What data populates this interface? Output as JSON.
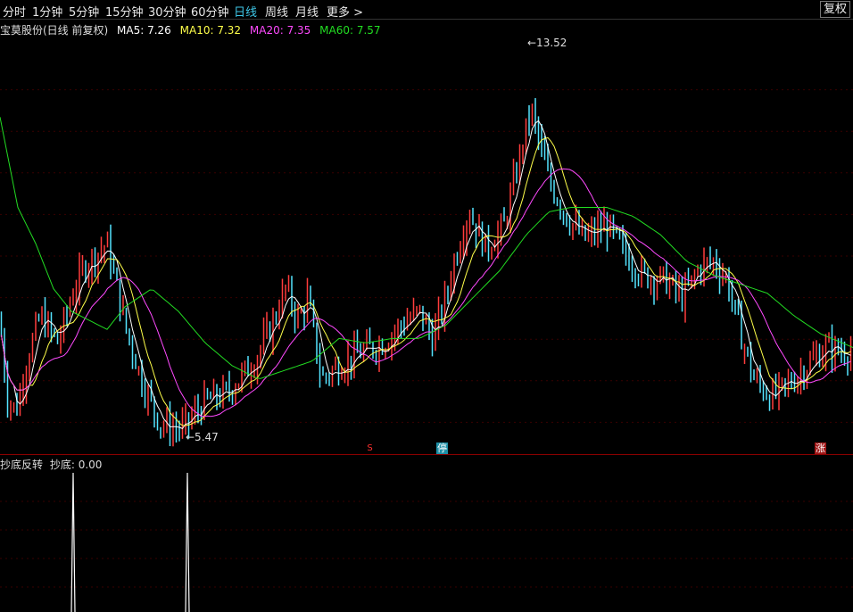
{
  "toolbar": {
    "periods": [
      "分时",
      "1分钟",
      "5分钟",
      "15分钟",
      "30分钟",
      "60分钟",
      "日线",
      "周线",
      "月线"
    ],
    "active_period": "日线",
    "more_label": "更多 >",
    "fuquan_label": "复权"
  },
  "legend": {
    "title": "宝莫股份(日线 前复权)",
    "ma5": "MA5: 7.26",
    "ma10": "MA10: 7.32",
    "ma20": "MA20: 7.35",
    "ma60": "MA60: 7.57"
  },
  "colors": {
    "up": "#ff3c3c",
    "down": "#54e4ff",
    "ma5": "#ffffff",
    "ma10": "#ffff4a",
    "ma20": "#ff4aff",
    "ma60": "#22dd22",
    "grid": "#3a0000"
  },
  "annotations": {
    "high_label": "13.52",
    "low_label": "5.47"
  },
  "badges": {
    "s": "S",
    "ting": "停",
    "zhang": "涨"
  },
  "indicator": {
    "title": "抄底反转",
    "value": "抄底: 0.00"
  },
  "chart_data": {
    "type": "candlestick",
    "price_range": [
      5.0,
      14.2
    ],
    "anchors": [
      [
        0,
        7.9
      ],
      [
        8,
        6.2
      ],
      [
        18,
        5.9
      ],
      [
        30,
        7.0
      ],
      [
        45,
        8.0
      ],
      [
        65,
        7.4
      ],
      [
        80,
        8.4
      ],
      [
        95,
        9.1
      ],
      [
        120,
        9.6
      ],
      [
        140,
        7.8
      ],
      [
        160,
        6.5
      ],
      [
        180,
        5.6
      ],
      [
        205,
        5.5
      ],
      [
        230,
        6.1
      ],
      [
        255,
        6.3
      ],
      [
        285,
        7.0
      ],
      [
        305,
        7.8
      ],
      [
        320,
        8.6
      ],
      [
        335,
        7.9
      ],
      [
        345,
        8.4
      ],
      [
        360,
        6.6
      ],
      [
        380,
        6.9
      ],
      [
        405,
        7.2
      ],
      [
        430,
        7.4
      ],
      [
        450,
        7.8
      ],
      [
        470,
        8.1
      ],
      [
        485,
        7.5
      ],
      [
        500,
        8.4
      ],
      [
        510,
        9.3
      ],
      [
        525,
        10.3
      ],
      [
        545,
        9.5
      ],
      [
        565,
        10.0
      ],
      [
        580,
        11.3
      ],
      [
        595,
        12.6
      ],
      [
        615,
        11.0
      ],
      [
        635,
        10.2
      ],
      [
        655,
        9.7
      ],
      [
        680,
        10.0
      ],
      [
        700,
        9.4
      ],
      [
        720,
        8.9
      ],
      [
        745,
        8.8
      ],
      [
        765,
        8.4
      ],
      [
        785,
        9.1
      ],
      [
        800,
        9.2
      ],
      [
        815,
        8.8
      ],
      [
        830,
        7.6
      ],
      [
        845,
        6.6
      ],
      [
        865,
        6.2
      ],
      [
        885,
        6.5
      ],
      [
        905,
        6.9
      ],
      [
        925,
        7.3
      ],
      [
        945,
        7.2
      ],
      [
        956,
        7.3
      ]
    ],
    "ma60_anchors": [
      [
        0,
        12.4
      ],
      [
        20,
        10.4
      ],
      [
        40,
        9.6
      ],
      [
        60,
        8.6
      ],
      [
        80,
        8.1
      ],
      [
        100,
        7.9
      ],
      [
        120,
        7.7
      ],
      [
        140,
        8.2
      ],
      [
        170,
        8.6
      ],
      [
        200,
        8.1
      ],
      [
        230,
        7.4
      ],
      [
        260,
        6.9
      ],
      [
        290,
        6.6
      ],
      [
        320,
        6.8
      ],
      [
        350,
        7.0
      ],
      [
        380,
        7.5
      ],
      [
        410,
        7.4
      ],
      [
        440,
        7.5
      ],
      [
        470,
        7.5
      ],
      [
        500,
        7.8
      ],
      [
        530,
        8.4
      ],
      [
        560,
        9.0
      ],
      [
        590,
        9.8
      ],
      [
        615,
        10.3
      ],
      [
        640,
        10.4
      ],
      [
        680,
        10.4
      ],
      [
        710,
        10.2
      ],
      [
        740,
        9.8
      ],
      [
        770,
        9.2
      ],
      [
        800,
        8.9
      ],
      [
        830,
        8.7
      ],
      [
        860,
        8.5
      ],
      [
        890,
        8.0
      ],
      [
        920,
        7.6
      ],
      [
        956,
        7.3
      ]
    ],
    "spikes_x": [
      82,
      210
    ],
    "indicator_values": "0 except two spikes of 1"
  }
}
